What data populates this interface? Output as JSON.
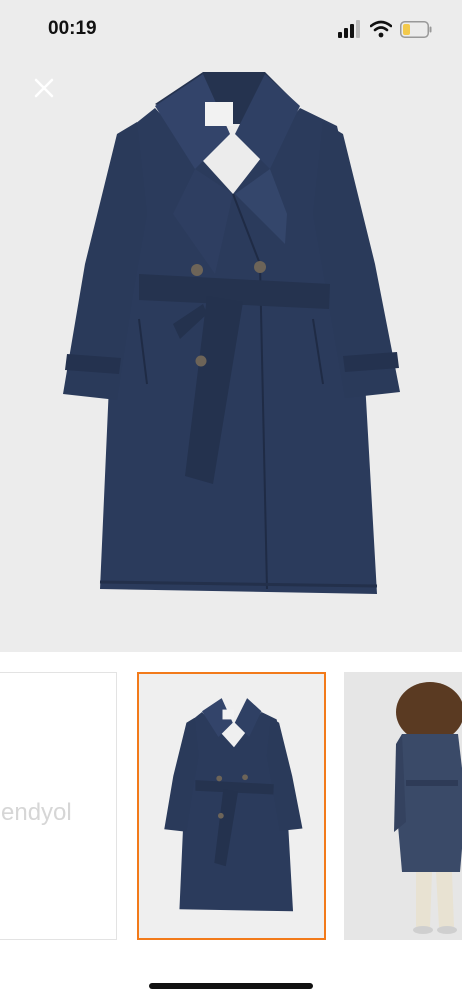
{
  "status_bar": {
    "time": "00:19"
  },
  "gallery": {
    "thumbnails": [
      {
        "label": "endyol"
      },
      {
        "label": ""
      },
      {
        "label": ""
      }
    ],
    "selected_index": 1
  },
  "colors": {
    "coat_navy": "#2b3b5c",
    "selection_border": "#f27a1a"
  },
  "icons": [
    "signal-icon",
    "wifi-icon",
    "battery-icon",
    "close-icon"
  ]
}
